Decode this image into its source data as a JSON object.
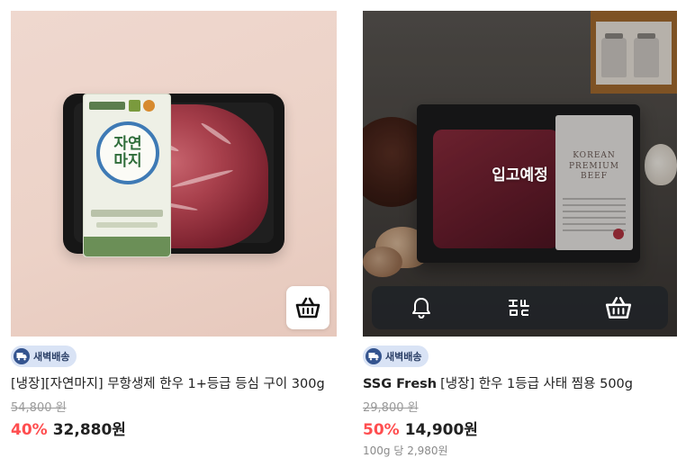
{
  "products": [
    {
      "badge": "새벽배송",
      "brand": "",
      "title": "[냉장][자연마지] 무항생제 한우 1+등급 등심 구이 300g",
      "original_price": "54,800 원",
      "discount": "40%",
      "price": "32,880원",
      "package_logo_text": "자연마지",
      "cart_icon": "basket-icon"
    },
    {
      "badge": "새벽배송",
      "brand": "SSG Fresh",
      "title": "[냉장] 한우 1등급 사태 찜용 500g",
      "original_price": "29,800 원",
      "discount": "50%",
      "price": "14,900원",
      "unit_price": "100g 당 2,980원",
      "status_overlay": "입고예정",
      "package_label": "KOREAN PREMIUM BEEF",
      "actions": [
        "bell-icon",
        "chat-icon",
        "basket-icon"
      ]
    }
  ],
  "colors": {
    "discount": "#ff4d4f",
    "badge_bg": "#d9e3f5",
    "badge_text": "#2a3f66"
  }
}
